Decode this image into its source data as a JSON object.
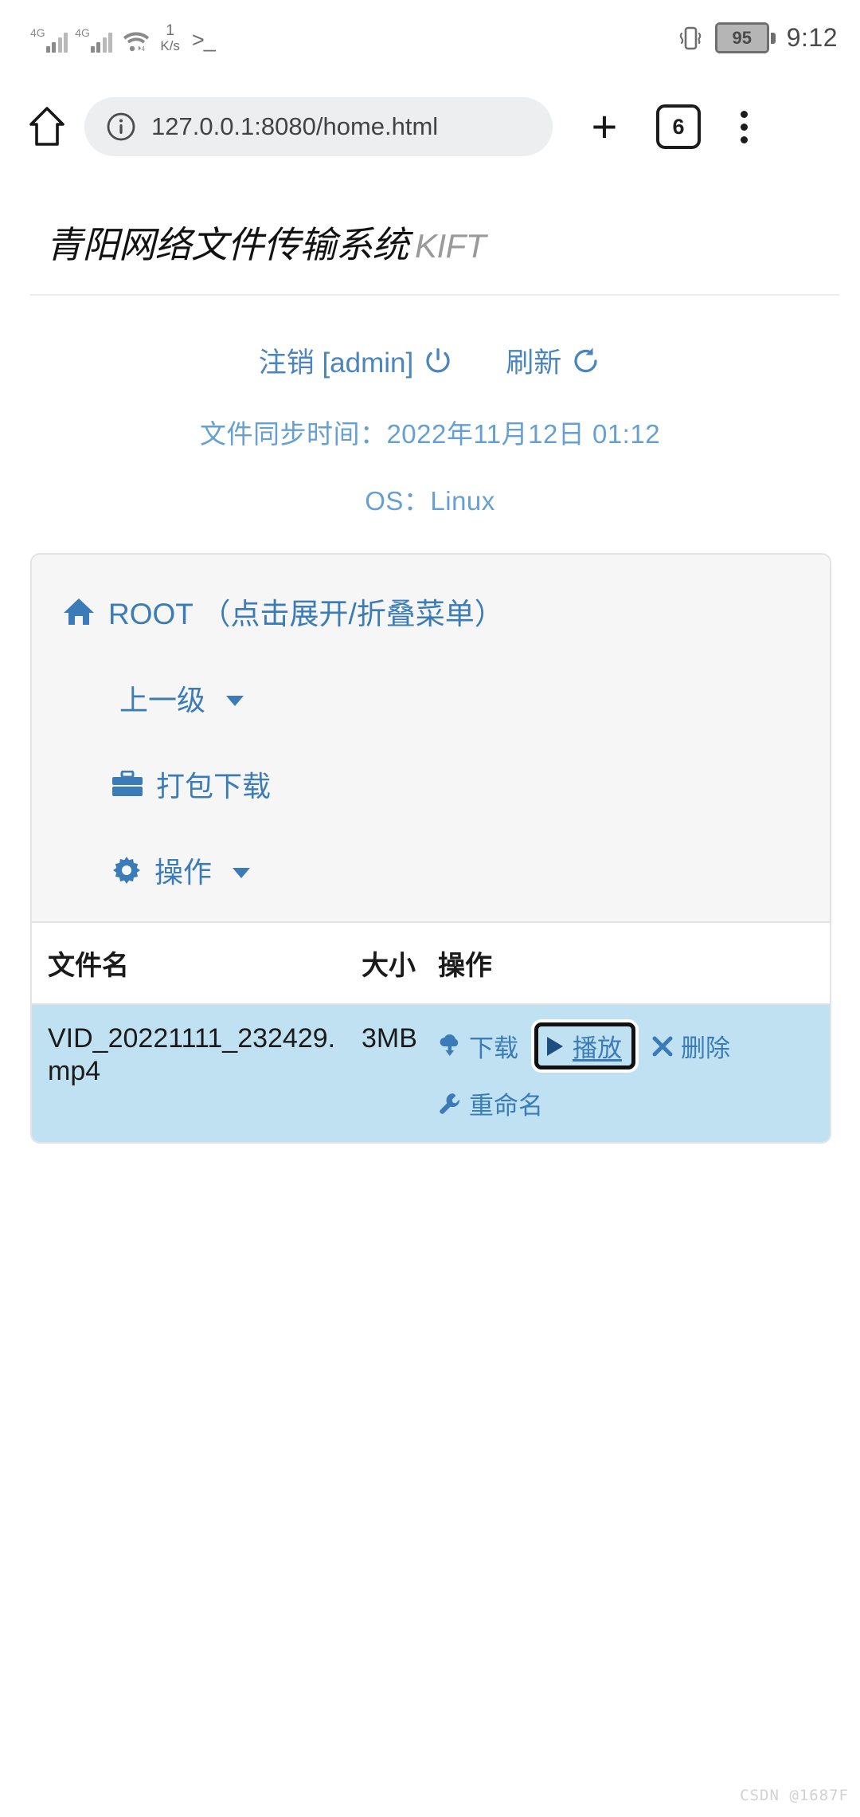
{
  "status_bar": {
    "network_type_1": "4G",
    "network_type_2": "4G",
    "net_speed_value": "1",
    "net_speed_unit": "K/s",
    "shell_indicator": ">_",
    "battery_percent": "95",
    "clock": "9:12"
  },
  "browser": {
    "url": "127.0.0.1:8080/home.html",
    "tab_count": "6",
    "home_icon": "home-icon",
    "info_icon": "info-circle-icon",
    "new_tab_icon": "plus-icon",
    "menu_icon": "overflow-menu-icon"
  },
  "header": {
    "title": "青阳网络文件传输系统",
    "subtitle": "KIFT"
  },
  "actions": {
    "logout_label": "注销 [admin]",
    "logout_icon": "power-icon",
    "refresh_label": "刷新",
    "refresh_icon": "refresh-icon"
  },
  "info": {
    "sync_time": "文件同步时间：2022年11月12日 01:12",
    "os": "OS：Linux"
  },
  "card": {
    "root_label": "ROOT （点击展开/折叠菜单）",
    "root_icon": "home-solid-icon",
    "menu": [
      {
        "label": "上一级",
        "icon": "none",
        "caret": true
      },
      {
        "label": "打包下载",
        "icon": "briefcase-icon",
        "caret": false
      },
      {
        "label": "操作",
        "icon": "gear-icon",
        "caret": true
      }
    ]
  },
  "table": {
    "headers": {
      "name": "文件名",
      "size": "大小",
      "ops": "操作"
    },
    "rows": [
      {
        "name": "VID_20221111_232429.mp4",
        "size": "3MB",
        "highlighted": true,
        "ops": [
          {
            "label": "下载",
            "icon": "download-cloud-icon",
            "focused": false
          },
          {
            "label": "播放",
            "icon": "play-icon",
            "focused": true
          },
          {
            "label": "删除",
            "icon": "close-x-icon",
            "focused": false
          },
          {
            "label": "重命名",
            "icon": "wrench-icon",
            "focused": false
          }
        ]
      }
    ]
  },
  "watermark": "CSDN @1687F",
  "colors": {
    "accent_blue": "#3b7cb8",
    "info_blue": "#66a0d2",
    "row_highlight": "#bfe1f2",
    "card_menu_bg": "#f6f6f6",
    "omnibox_bg": "#eceef0"
  }
}
